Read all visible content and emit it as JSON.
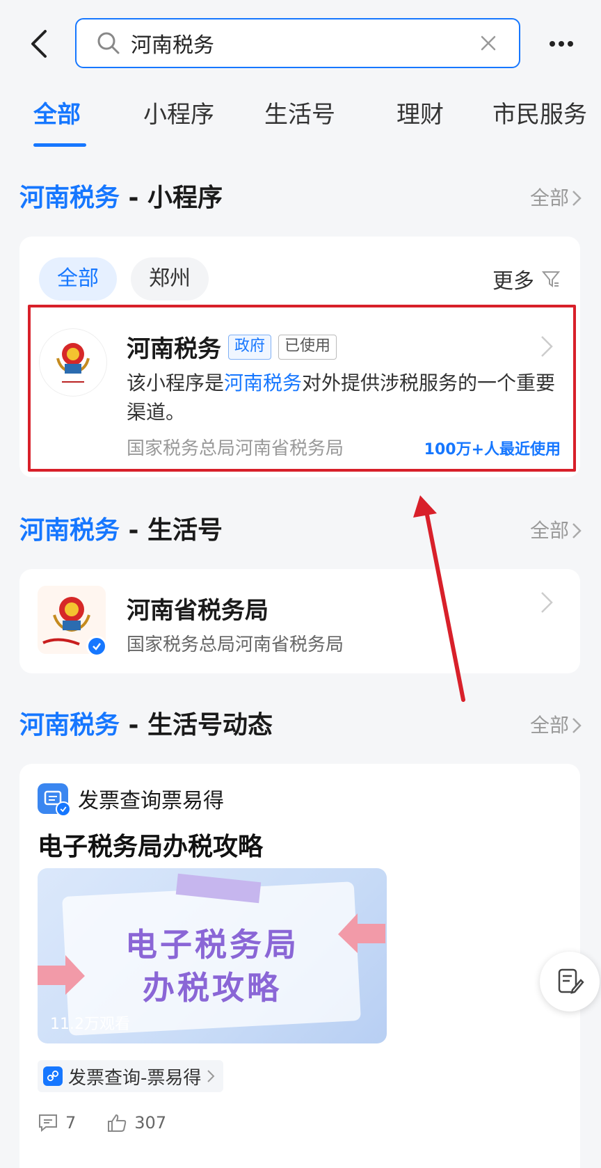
{
  "search": {
    "query": "河南税务"
  },
  "tabs": [
    "全部",
    "小程序",
    "生活号",
    "理财",
    "市民服务"
  ],
  "sections": {
    "mini": {
      "highlight": "河南税务",
      "suffix": " - 小程序",
      "more": "全部"
    },
    "life": {
      "highlight": "河南税务",
      "suffix": " - 生活号",
      "more": "全部"
    },
    "feed": {
      "highlight": "河南税务",
      "suffix": " - 生活号动态",
      "more": "全部"
    }
  },
  "mini_card": {
    "chips": [
      "全部",
      "郑州"
    ],
    "filter_more": "更多",
    "item": {
      "title": "河南税务",
      "tags": [
        "政府",
        "已使用"
      ],
      "desc_pre": "该小程序是",
      "desc_hl": "河南税务",
      "desc_post": "对外提供涉税服务的一个重要渠道。",
      "org": "国家税务总局河南省税务局",
      "usage": "100万+人最近使用"
    }
  },
  "life_card": {
    "title": "河南省税务局",
    "org": "国家税务总局河南省税务局"
  },
  "feed_card": {
    "account": "发票查询票易得",
    "title": "电子税务局办税攻略",
    "thumb_line1": "电子税务局",
    "thumb_line2": "办税攻略",
    "views": "11.2万观看",
    "link": "发票查询-票易得",
    "comments": "7",
    "likes": "307"
  },
  "colors": {
    "accent": "#1677ff",
    "highlight_box": "#d8202a",
    "annotation_arrow": "#d8202a"
  }
}
